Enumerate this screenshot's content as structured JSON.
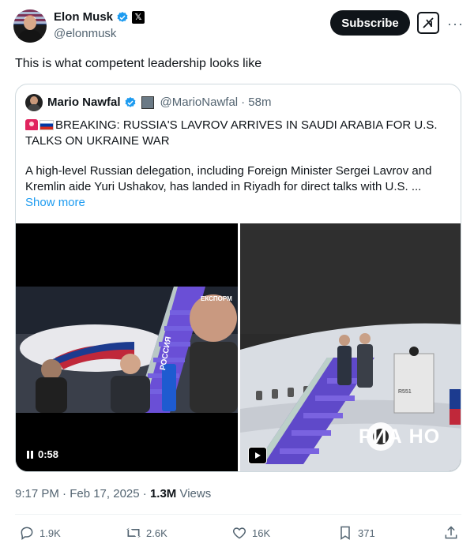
{
  "author": {
    "name": "Elon Musk",
    "handle": "@elonmusk",
    "subscribe_label": "Subscribe"
  },
  "tweet": {
    "text": "This is what competent leadership looks like",
    "timestamp": "9:17 PM · Feb 17, 2025 · ",
    "views_count": "1.3M",
    "views_label": " Views"
  },
  "quote": {
    "name": "Mario Nawfal",
    "handle": "@MarioNawfal",
    "time": "· 58m",
    "title": "BREAKING: RUSSIA'S LAVROV ARRIVES IN SAUDI ARABIA FOR U.S. TALKS ON UKRAINE WAR",
    "body": "A high-level Russian delegation, including Foreign Minister Sergei Lavrov and Kremlin aide Yuri Ushakov, has landed in Riyadh for direct talks with U.S. ...",
    "show_more": "Show more",
    "video_duration": "0:58",
    "right_watermark": "РИА НО",
    "left_mic_text": "РОССИЯ",
    "left_tv_logo": "ЕКСПОРМ"
  },
  "actions": {
    "replies": "1.9K",
    "reposts": "2.6K",
    "likes": "16K",
    "bookmarks": "371"
  },
  "colors": {
    "accent": "#1d9bf0",
    "text": "#0f1419",
    "muted": "#536471",
    "border": "#cfd9de"
  },
  "icons": [
    "verified-badge-icon",
    "x-badge-icon",
    "grok-icon",
    "more-icon",
    "reply-icon",
    "repost-icon",
    "like-icon",
    "bookmark-icon",
    "share-icon",
    "pause-icon",
    "play-icon"
  ]
}
